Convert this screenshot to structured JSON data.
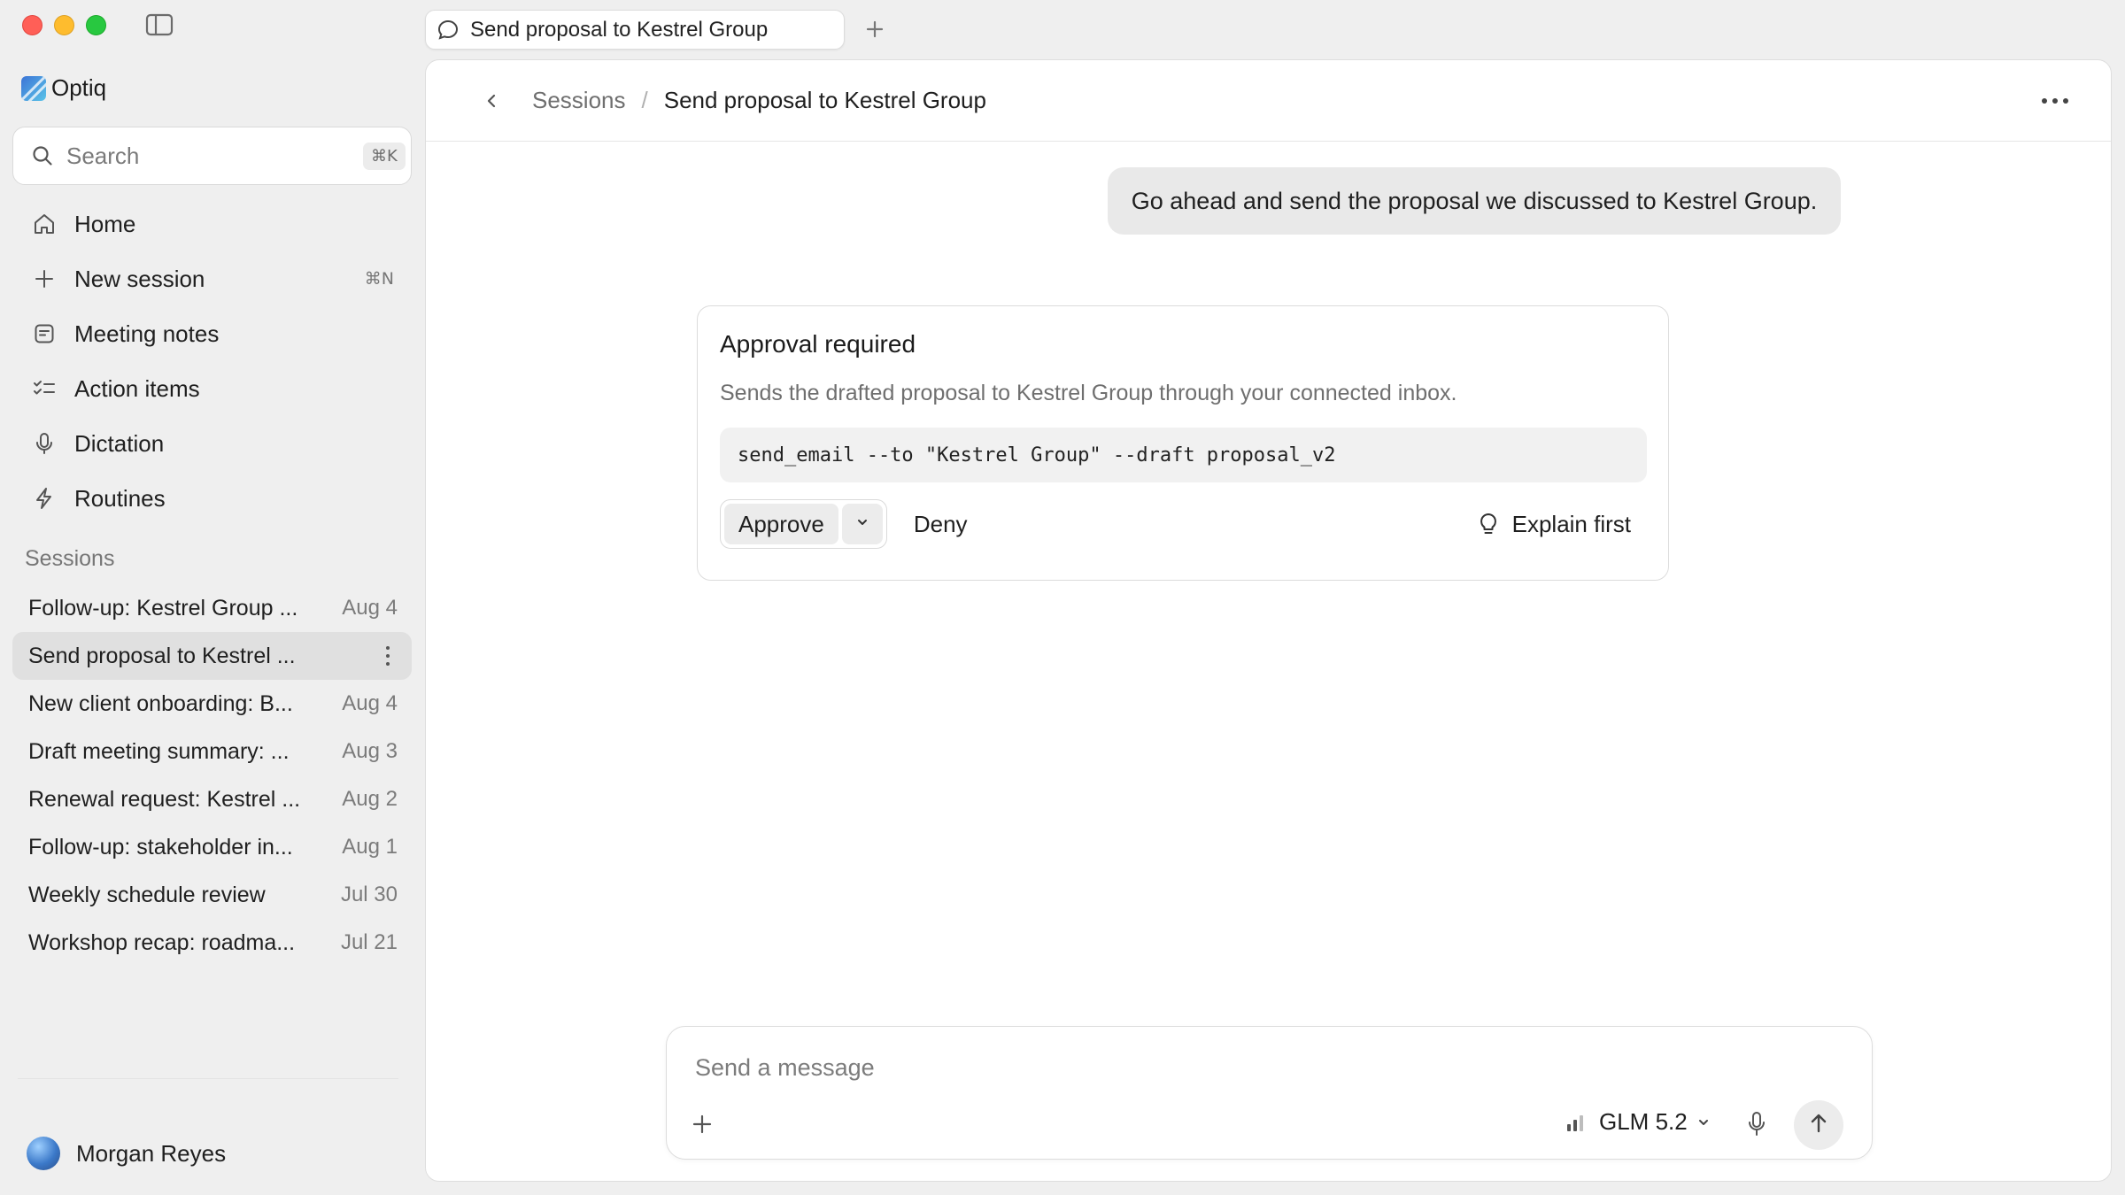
{
  "window": {
    "tab_title": "Send proposal to Kestrel Group"
  },
  "sidebar": {
    "brand": "Optiq",
    "search": {
      "placeholder": "Search",
      "shortcut": "⌘K"
    },
    "nav": [
      {
        "label": "Home",
        "icon": "home-icon"
      },
      {
        "label": "New session",
        "icon": "plus-icon",
        "shortcut": "⌘N"
      },
      {
        "label": "Meeting notes",
        "icon": "note-icon"
      },
      {
        "label": "Action items",
        "icon": "checklist-icon"
      },
      {
        "label": "Dictation",
        "icon": "microphone-icon"
      },
      {
        "label": "Routines",
        "icon": "bolt-icon"
      }
    ],
    "sessions_heading": "Sessions",
    "sessions": [
      {
        "title": "Follow-up: Kestrel Group ...",
        "date": "Aug 4"
      },
      {
        "title": "Send proposal to Kestrel ...",
        "date": "",
        "active": true
      },
      {
        "title": "New client onboarding: B...",
        "date": "Aug 4"
      },
      {
        "title": "Draft meeting summary: ...",
        "date": "Aug 3"
      },
      {
        "title": "Renewal request: Kestrel ...",
        "date": "Aug 2"
      },
      {
        "title": "Follow-up: stakeholder in...",
        "date": "Aug 1"
      },
      {
        "title": "Weekly schedule review",
        "date": "Jul 30"
      },
      {
        "title": "Workshop recap: roadma...",
        "date": "Jul 21"
      }
    ],
    "user": {
      "name": "Morgan Reyes"
    }
  },
  "header": {
    "breadcrumb_root": "Sessions",
    "breadcrumb_sep": "/",
    "breadcrumb_current": "Send proposal to Kestrel Group"
  },
  "conversation": {
    "user_message": "Go ahead and send the proposal we discussed to Kestrel Group."
  },
  "approval": {
    "title": "Approval required",
    "description": "Sends the drafted proposal to Kestrel Group through your connected inbox.",
    "command": "send_email --to \"Kestrel Group\" --draft proposal_v2",
    "approve_label": "Approve",
    "deny_label": "Deny",
    "explain_label": "Explain first"
  },
  "composer": {
    "placeholder": "Send a message",
    "model": "GLM 5.2"
  },
  "colors": {
    "close": "#ff5f57",
    "minimize": "#febc2e",
    "zoom": "#28c840",
    "brand": "#3c74d6"
  }
}
